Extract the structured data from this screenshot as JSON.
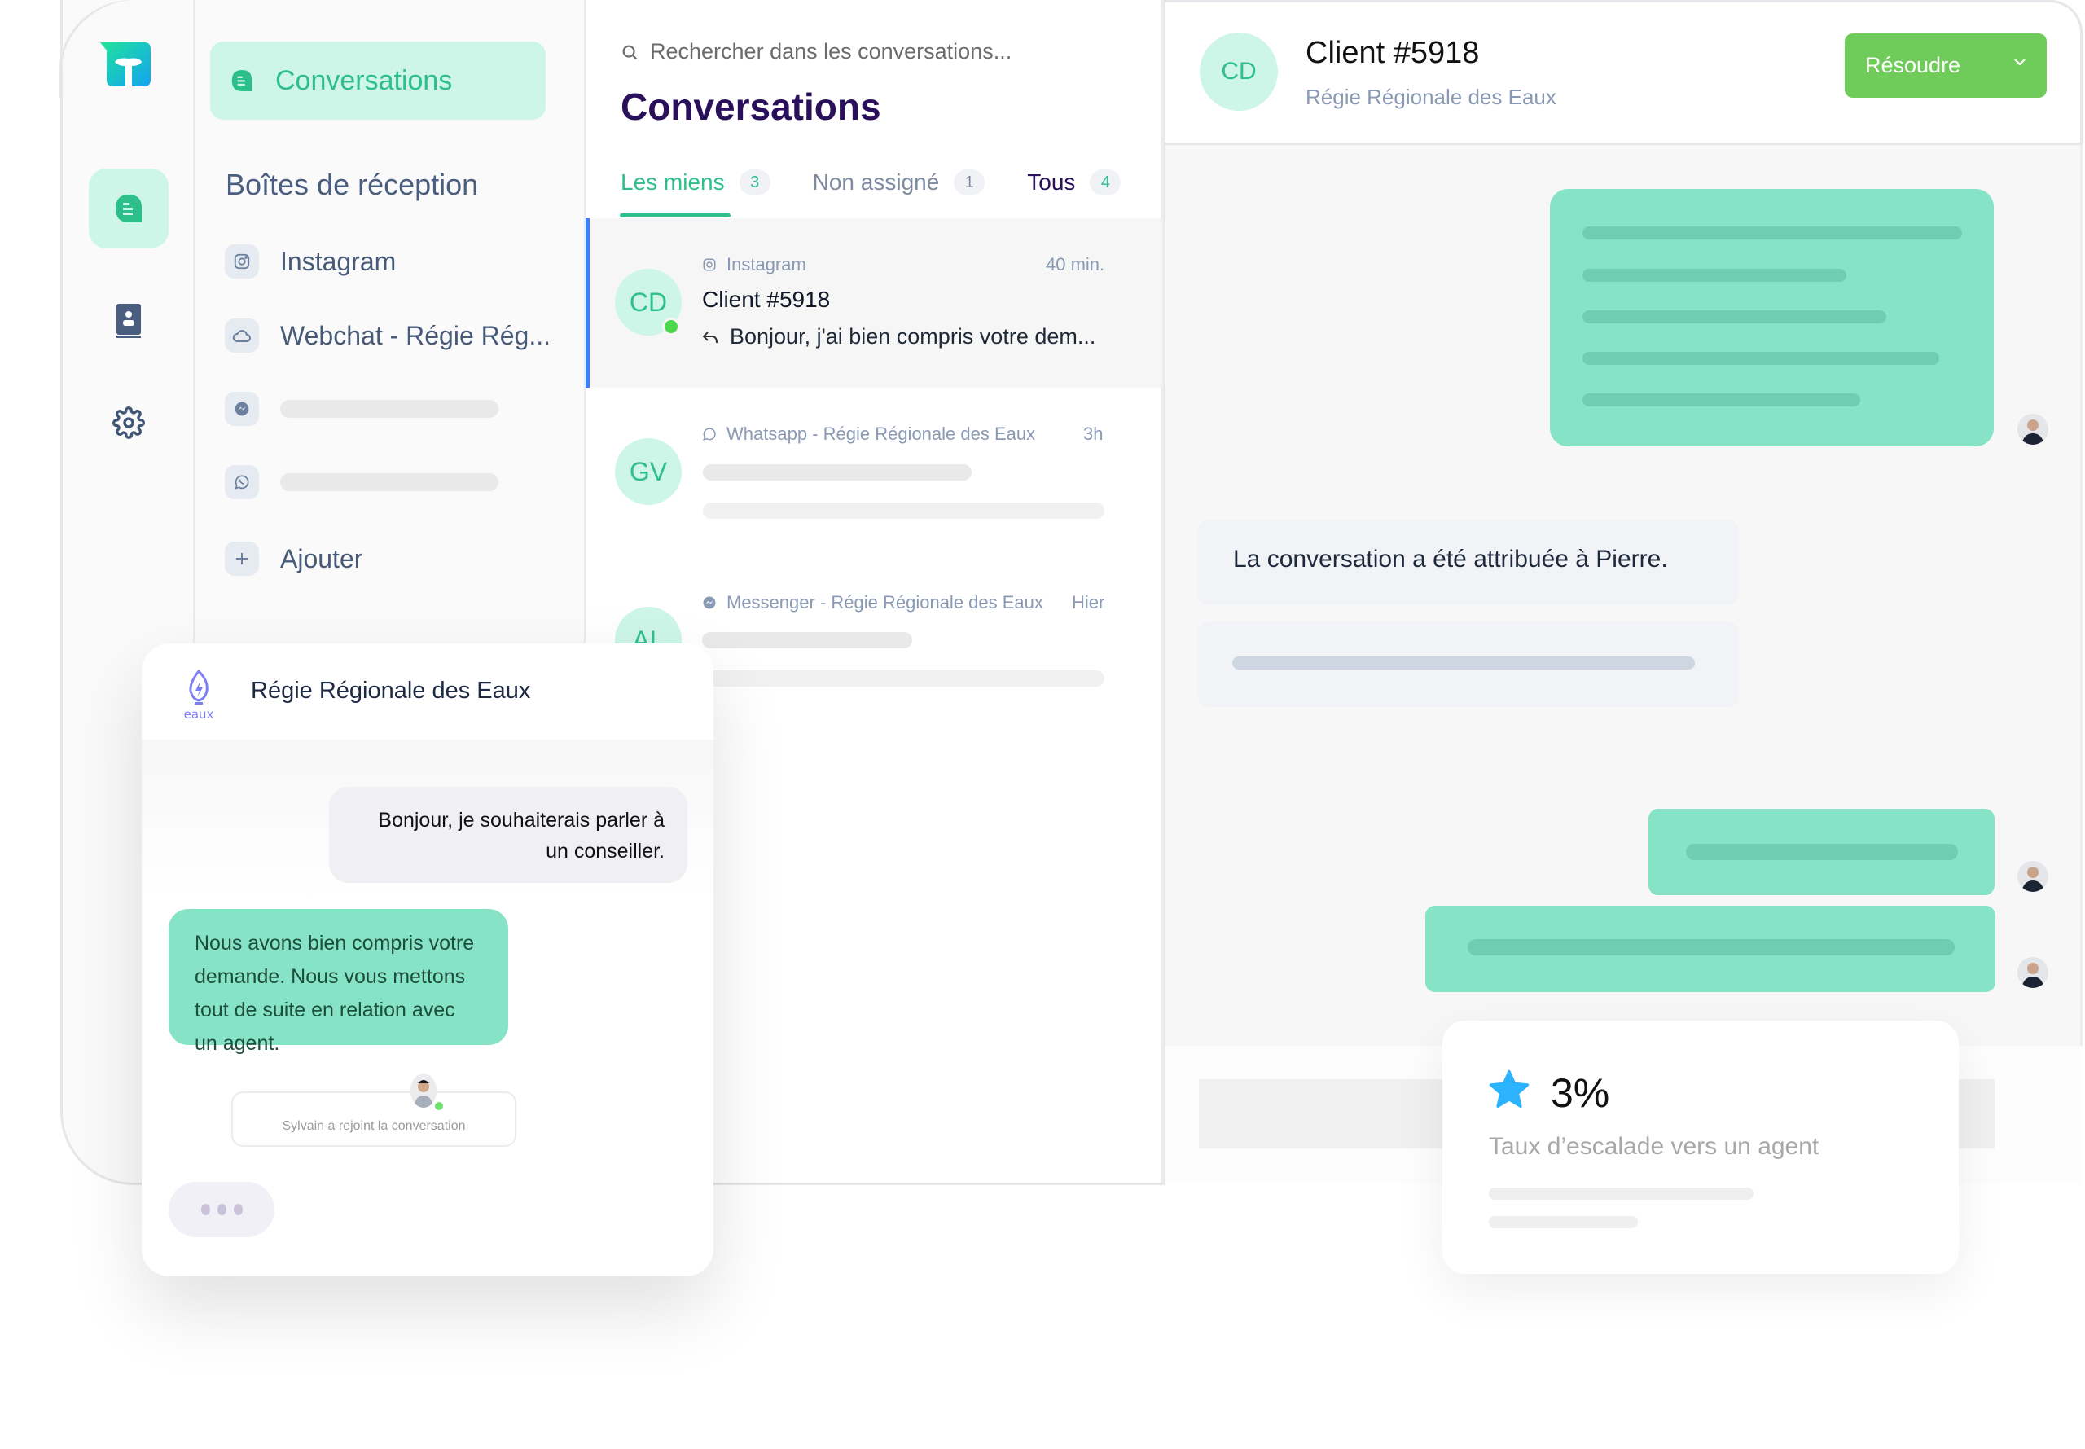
{
  "colors": {
    "accent_green": "#2fbf8a",
    "accent_light": "#cdf5e8",
    "bubble_green": "#86e3c6",
    "resolve_green": "#6fcc5b",
    "title_purple": "#2a0f5a",
    "selected_border": "#3b82f6",
    "star_blue": "#2bb3ff"
  },
  "rail": {
    "icons": [
      "logo-icon",
      "conversations-icon",
      "contacts-book-icon",
      "settings-gear-icon"
    ]
  },
  "sidebar": {
    "active_item": "Conversations",
    "heading": "Boîtes de réception",
    "inboxes": [
      {
        "icon": "instagram-icon",
        "label": "Instagram"
      },
      {
        "icon": "cloud-icon",
        "label": "Webchat - Régie  Rég..."
      },
      {
        "icon": "messenger-icon",
        "label": ""
      },
      {
        "icon": "whatsapp-icon",
        "label": ""
      },
      {
        "icon": "plus-icon",
        "label": "Ajouter"
      }
    ]
  },
  "conversation_list": {
    "search_placeholder": "Rechercher dans les conversations...",
    "title": "Conversations",
    "tabs": [
      {
        "label": "Les miens",
        "count": "3",
        "active": true
      },
      {
        "label": "Non assigné",
        "count": "1",
        "active": false
      },
      {
        "label": "Tous",
        "count": "4",
        "active": false
      }
    ],
    "rows": [
      {
        "initials": "CD",
        "source": "Instagram",
        "time": "40 min.",
        "name": "Client #5918",
        "preview": "Bonjour, j'ai bien compris votre dem...",
        "online": true,
        "selected": true
      },
      {
        "initials": "GV",
        "source": "Whatsapp - Régie Régionale des Eaux",
        "time": "3h",
        "name": "",
        "preview": ""
      },
      {
        "initials": "AL",
        "source": "Messenger - Régie Régionale des Eaux",
        "time": "Hier",
        "name": "",
        "preview": ""
      }
    ]
  },
  "chat": {
    "initials": "CD",
    "name": "Client #5918",
    "subtitle": "Régie Régionale des Eaux",
    "resolve_label": "Résoudre",
    "system_message": "La conversation a été attribuée à Pierre."
  },
  "stat_card": {
    "value": "3%",
    "label": "Taux d’escalade vers un agent"
  },
  "widget": {
    "logo_text": "eaux",
    "title": "Régie Régionale des Eaux",
    "user_message": "Bonjour, je souhaiterais parler à un conseiller.",
    "bot_message": "Nous avons bien compris votre demande. Nous vous mettons tout de suite en relation avec un agent.",
    "join_notice": "Sylvain a rejoint la conversation"
  }
}
